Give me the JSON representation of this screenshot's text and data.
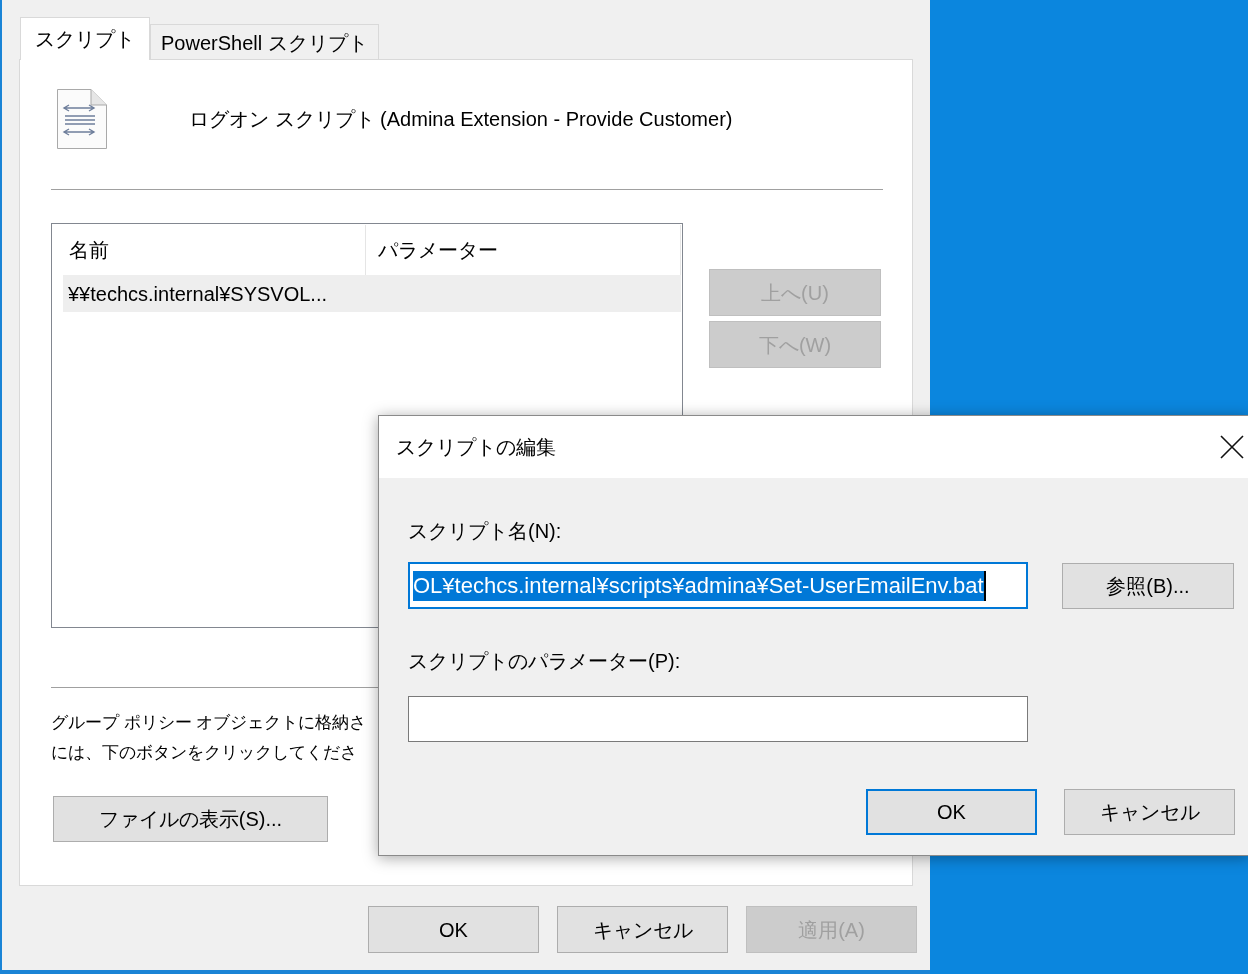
{
  "main_window": {
    "tabs": [
      {
        "label": "スクリプト",
        "selected": true
      },
      {
        "label": "PowerShell スクリプト",
        "selected": false
      }
    ],
    "header": {
      "title": "ログオン スクリプト (Admina Extension - Provide Customer)"
    },
    "script_list": {
      "columns": [
        "名前",
        "パラメーター"
      ],
      "rows": [
        {
          "name": "¥¥techcs.internal¥SYSVOL...",
          "selected": true
        }
      ]
    },
    "side_buttons": [
      {
        "label": "上へ(U)",
        "disabled": true
      },
      {
        "label": "下へ(W)",
        "disabled": true
      }
    ],
    "note_lines": [
      "グループ ポリシー オブジェクトに格納さ",
      "には、下のボタンをクリックしてくださ"
    ],
    "show_files_button": {
      "label": "ファイルの表示(S)..."
    },
    "footer_buttons": [
      {
        "label": "OK",
        "disabled": false
      },
      {
        "label": "キャンセル",
        "disabled": false
      },
      {
        "label": "適用(A)",
        "disabled": true
      }
    ]
  },
  "edit_dialog": {
    "title": "スクリプトの編集",
    "script_name": {
      "label": "スクリプト名(N):",
      "value": "OL¥techcs.internal¥scripts¥admina¥Set-UserEmailEnv.bat",
      "focused": true,
      "text_selected": true
    },
    "browse_button": {
      "label": "参照(B)..."
    },
    "parameters": {
      "label": "スクリプトのパラメーター(P):"
    },
    "buttons": [
      {
        "label": "OK",
        "default": true
      },
      {
        "label": "キャンセル",
        "default": false
      }
    ]
  }
}
